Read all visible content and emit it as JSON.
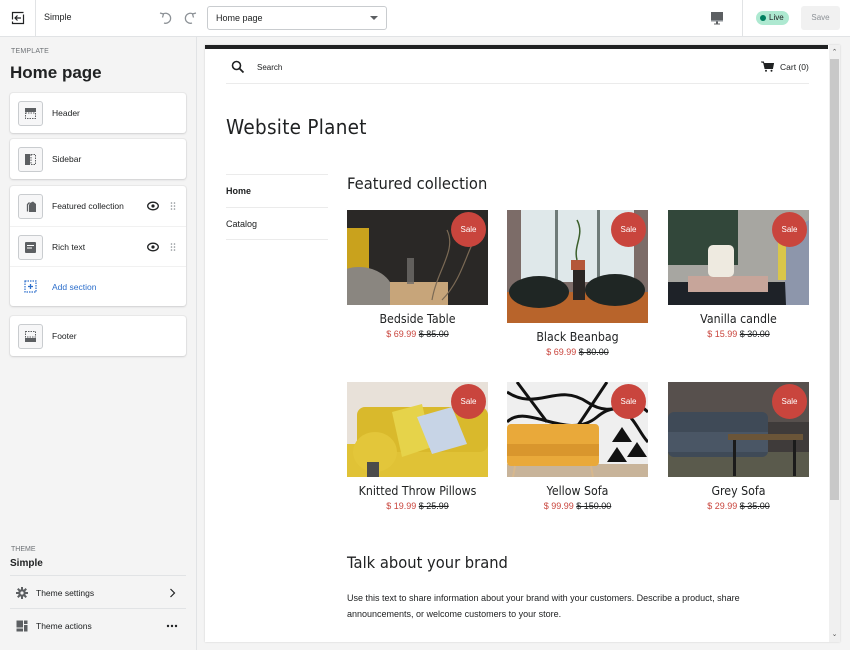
{
  "topbar": {
    "theme_name": "Simple",
    "page_select": "Home page",
    "status_badge": "Live",
    "save_label": "Save"
  },
  "colors": {
    "accent_link": "#2c6ecb",
    "live_badge_bg": "#aee9d1",
    "live_dot": "#007f5f",
    "sale_red": "#c9453d"
  },
  "sidebar": {
    "template_label": "TEMPLATE",
    "template_title": "Home page",
    "sections": [
      {
        "label": "Header",
        "icon": "header-icon"
      },
      {
        "label": "Sidebar",
        "icon": "sidebar-icon"
      },
      {
        "label": "Featured collection",
        "icon": "tag-icon"
      },
      {
        "label": "Rich text",
        "icon": "text-block-icon"
      },
      {
        "label": "Add section",
        "icon": "add-section-icon"
      },
      {
        "label": "Footer",
        "icon": "footer-icon"
      }
    ],
    "theme_label": "THEME",
    "theme_name": "Simple",
    "theme_settings": "Theme settings",
    "theme_actions": "Theme actions"
  },
  "preview": {
    "search_label": "Search",
    "cart_label": "Cart (0)",
    "store_name": "Website Planet",
    "nav": [
      {
        "label": "Home",
        "active": true
      },
      {
        "label": "Catalog",
        "active": false
      }
    ],
    "featured_title": "Featured collection",
    "sale_badge": "Sale",
    "products": [
      {
        "name": "Bedside Table",
        "price": "$ 69.99",
        "compare_price": "$ 85.00"
      },
      {
        "name": "Black Beanbag",
        "price": "$ 69.99",
        "compare_price": "$ 80.00"
      },
      {
        "name": "Vanilla candle",
        "price": "$ 15.99",
        "compare_price": "$ 30.00"
      },
      {
        "name": "Knitted Throw Pillows",
        "price": "$ 19.99",
        "compare_price": "$ 25.99"
      },
      {
        "name": "Yellow Sofa",
        "price": "$ 99.99",
        "compare_price": "$ 150.00"
      },
      {
        "name": "Grey Sofa",
        "price": "$ 29.99",
        "compare_price": "$ 35.00"
      }
    ],
    "brand_title": "Talk about your brand",
    "brand_text": "Use this text to share information about your brand with your customers. Describe a product, share announcements, or welcome customers to your store."
  }
}
